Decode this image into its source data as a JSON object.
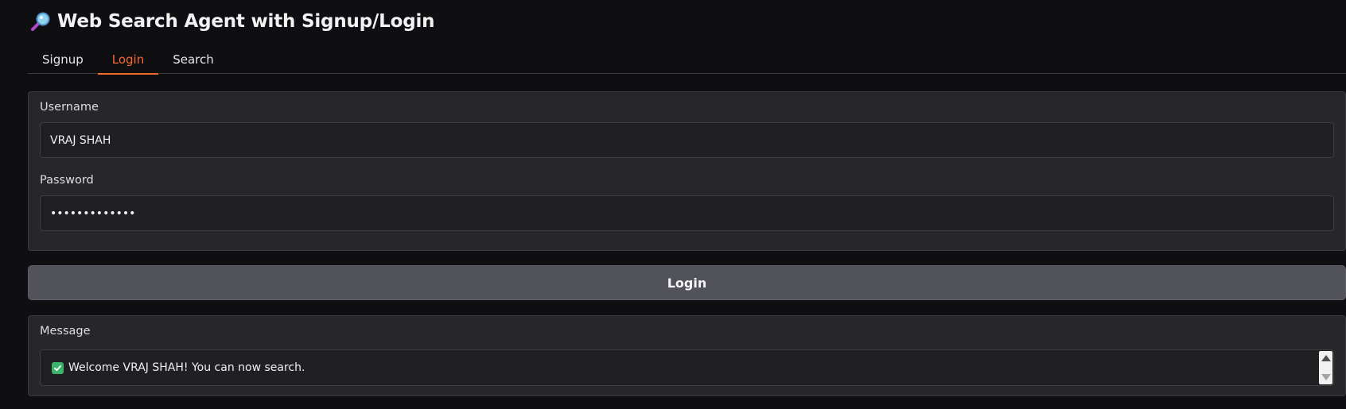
{
  "header": {
    "title": "Web Search Agent with Signup/Login",
    "icon": "magnifying-glass-icon"
  },
  "tabs": [
    {
      "label": "Signup",
      "active": false
    },
    {
      "label": "Login",
      "active": true
    },
    {
      "label": "Search",
      "active": false
    }
  ],
  "login_form": {
    "username_label": "Username",
    "username_value": "VRAJ SHAH",
    "password_label": "Password",
    "password_value": "•••••••••••••",
    "submit_label": "Login"
  },
  "message": {
    "label": "Message",
    "text": "Welcome VRAJ SHAH! You can now search.",
    "status_icon": "check-mark-icon"
  },
  "colors": {
    "background": "#0f0f11",
    "panel": "#27272a",
    "accent": "#f26a2d",
    "button": "#52525b",
    "success": "#3bb36b"
  }
}
